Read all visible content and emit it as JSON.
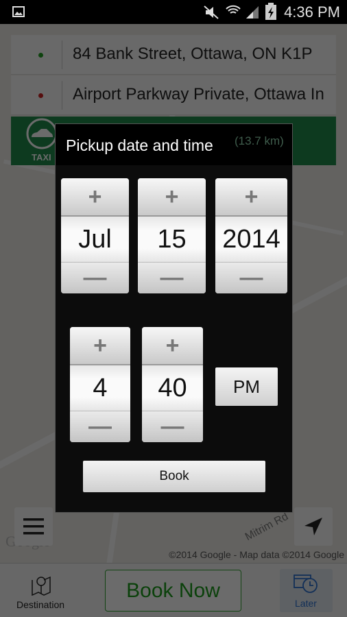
{
  "status_bar": {
    "time": "4:36 PM",
    "icons": [
      "image-icon",
      "mute-icon",
      "wifi-icon",
      "signal-icon",
      "battery-charging-icon"
    ]
  },
  "addresses": {
    "pickup": "84 Bank Street, Ottawa, ON K1P",
    "destination": "Airport Parkway Private, Ottawa In",
    "pickup_color": "#22a022",
    "destination_color": "#cc2222"
  },
  "taxi": {
    "label": "TAXI",
    "fare": "(13.7 km)"
  },
  "map": {
    "attribution": "©2014 Google - Map data ©2014 Google",
    "road_label": "Mitrim Rd",
    "logo": "Google"
  },
  "dialog": {
    "title": "Pickup date and time",
    "month": "Jul",
    "day": "15",
    "year": "2014",
    "hour": "4",
    "minute": "40",
    "ampm": "PM",
    "book": "Book"
  },
  "bottom": {
    "destination": "Destination",
    "book_now": "Book Now",
    "later": "Later"
  },
  "colors": {
    "accent_green": "#1e8a4a",
    "book_now_text": "#1a9a1a",
    "later_blue": "#2a6fd0"
  }
}
